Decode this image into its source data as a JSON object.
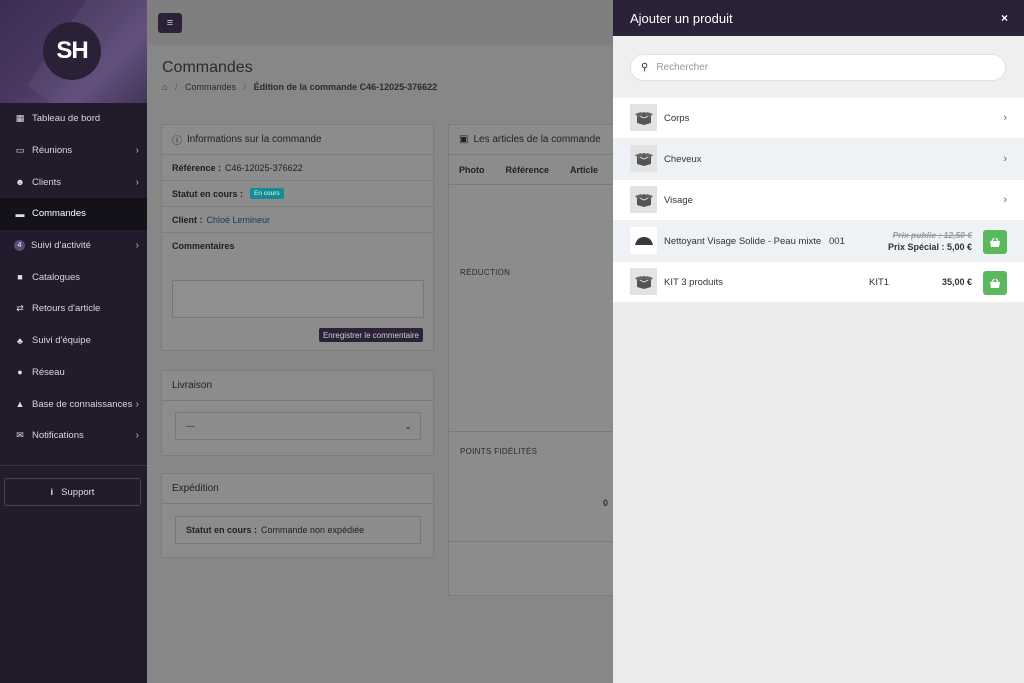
{
  "logo_text": "SH",
  "sidebar": {
    "items": [
      {
        "label": "Tableau de bord",
        "icon": "dashboard-icon",
        "chev": ""
      },
      {
        "label": "Réunions",
        "icon": "calendar-icon",
        "chev": "›"
      },
      {
        "label": "Clients",
        "icon": "users-icon",
        "chev": "›"
      },
      {
        "label": "Commandes",
        "icon": "card-icon",
        "chev": ""
      },
      {
        "label": "Suivi d'activité",
        "icon": "badge-icon",
        "chev": "›",
        "badge": "4"
      },
      {
        "label": "Catalogues",
        "icon": "book-icon",
        "chev": ""
      },
      {
        "label": "Retours d'article",
        "icon": "exchange-icon",
        "chev": ""
      },
      {
        "label": "Suivi d'équipe",
        "icon": "sitemap-icon",
        "chev": ""
      },
      {
        "label": "Réseau",
        "icon": "globe-icon",
        "chev": ""
      },
      {
        "label": "Base de connaissances",
        "icon": "graduation-icon",
        "chev": "›"
      },
      {
        "label": "Notifications",
        "icon": "envelope-icon",
        "chev": "›"
      }
    ],
    "support_label": "Support"
  },
  "page": {
    "title": "Commandes",
    "breadcrumb": [
      "Commandes",
      "Édition de la commande C46-12025-376622"
    ]
  },
  "info": {
    "title": "Informations sur la commande",
    "ref_label": "Référence :",
    "ref_value": "C46-12025-376622",
    "status_label": "Statut en cours :",
    "status_value": "En cours",
    "client_label": "Client :",
    "client_value": "Chloé Lemineur",
    "comments_label": "Commentaires",
    "save_label": "Enregistrer le commentaire"
  },
  "livraison": {
    "title": "Livraison",
    "select_value": "---"
  },
  "expedition": {
    "title": "Expédition",
    "status_label": "Statut en cours :",
    "status_value": "Commande non expédiée"
  },
  "articles": {
    "title": "Les articles de la commande",
    "columns": [
      "Photo",
      "Référence",
      "Article"
    ],
    "reduction_label": "RÉDUCTION",
    "points_label": "POINTS FIDÉLITÉS",
    "partial_value": "0"
  },
  "drawer": {
    "title": "Ajouter un produit",
    "close": "×",
    "search_placeholder": "Rechercher",
    "categories": [
      {
        "name": "Corps"
      },
      {
        "name": "Cheveux"
      },
      {
        "name": "Visage"
      }
    ],
    "products": [
      {
        "name": "Nettoyant Visage Solide - Peau mixte",
        "ref": "001",
        "old_price": "Prix public : 12,50 €",
        "special_price": "Prix Spécial : 5,00 €"
      },
      {
        "name": "KIT 3 produits",
        "ref": "KIT1",
        "price": "35,00 €"
      }
    ]
  },
  "colors": {
    "sidebar_bg": "#211b2b",
    "header_bg": "#2b2238",
    "cart_green": "#5cb85c",
    "status_teal": "#138d94"
  }
}
